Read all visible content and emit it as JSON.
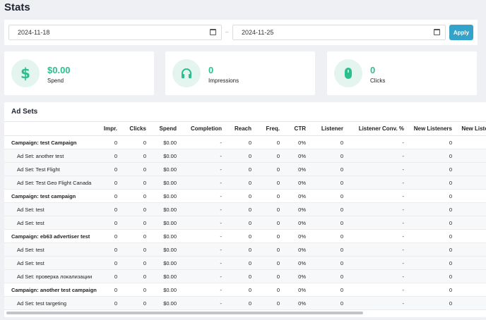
{
  "page": {
    "title": "Stats"
  },
  "date_range": {
    "start": "2024-11-18",
    "end": "2024-11-25",
    "separator": "–",
    "apply_label": "Apply"
  },
  "stats": [
    {
      "value": "$0.00",
      "label": "Spend",
      "icon": "dollar-icon"
    },
    {
      "value": "0",
      "label": "Impressions",
      "icon": "headphones-icon"
    },
    {
      "value": "0",
      "label": "Clicks",
      "icon": "mouse-icon"
    }
  ],
  "adsets": {
    "title": "Ad Sets",
    "columns": [
      "",
      "Impr.",
      "Clicks",
      "Spend",
      "Completion",
      "Reach",
      "Freq.",
      "CTR",
      "Listener",
      "Listener Conv. %",
      "New Listeners",
      "New Listene"
    ],
    "rows": [
      {
        "type": "campaign",
        "cells": [
          "Campaign: test Campaign",
          "0",
          "0",
          "$0.00",
          "-",
          "0",
          "0",
          "0%",
          "0",
          "-",
          "0",
          ""
        ]
      },
      {
        "type": "adset",
        "cells": [
          "Ad Set: another test",
          "0",
          "0",
          "$0.00",
          "-",
          "0",
          "0",
          "0%",
          "0",
          "-",
          "0",
          ""
        ]
      },
      {
        "type": "adset",
        "cells": [
          "Ad Set: Test Flight",
          "0",
          "0",
          "$0.00",
          "-",
          "0",
          "0",
          "0%",
          "0",
          "-",
          "0",
          ""
        ]
      },
      {
        "type": "adset",
        "cells": [
          "Ad Set: Test Geo Flight Canada",
          "0",
          "0",
          "$0.00",
          "-",
          "0",
          "0",
          "0%",
          "0",
          "-",
          "0",
          ""
        ]
      },
      {
        "type": "campaign",
        "cells": [
          "Campaign: test campaign",
          "0",
          "0",
          "$0.00",
          "-",
          "0",
          "0",
          "0%",
          "0",
          "-",
          "0",
          ""
        ]
      },
      {
        "type": "adset",
        "cells": [
          "Ad Set: test",
          "0",
          "0",
          "$0.00",
          "-",
          "0",
          "0",
          "0%",
          "0",
          "-",
          "0",
          ""
        ]
      },
      {
        "type": "adset",
        "cells": [
          "Ad Set: test",
          "0",
          "0",
          "$0.00",
          "-",
          "0",
          "0",
          "0%",
          "0",
          "-",
          "0",
          ""
        ]
      },
      {
        "type": "campaign",
        "cells": [
          "Campaign: eb63 advertiser test",
          "0",
          "0",
          "$0.00",
          "-",
          "0",
          "0",
          "0%",
          "0",
          "-",
          "0",
          ""
        ]
      },
      {
        "type": "adset",
        "cells": [
          "Ad Set: test",
          "0",
          "0",
          "$0.00",
          "-",
          "0",
          "0",
          "0%",
          "0",
          "-",
          "0",
          ""
        ]
      },
      {
        "type": "adset",
        "cells": [
          "Ad Set: test",
          "0",
          "0",
          "$0.00",
          "-",
          "0",
          "0",
          "0%",
          "0",
          "-",
          "0",
          ""
        ]
      },
      {
        "type": "adset",
        "cells": [
          "Ad Set: проверка локализации",
          "0",
          "0",
          "$0.00",
          "-",
          "0",
          "0",
          "0%",
          "0",
          "-",
          "0",
          ""
        ]
      },
      {
        "type": "campaign",
        "cells": [
          "Campaign: another test campaign",
          "0",
          "0",
          "$0.00",
          "-",
          "0",
          "0",
          "0%",
          "0",
          "-",
          "0",
          ""
        ]
      },
      {
        "type": "adset",
        "cells": [
          "Ad Set: test targeting",
          "0",
          "0",
          "$0.00",
          "-",
          "0",
          "0",
          "0%",
          "0",
          "-",
          "0",
          ""
        ]
      }
    ]
  }
}
